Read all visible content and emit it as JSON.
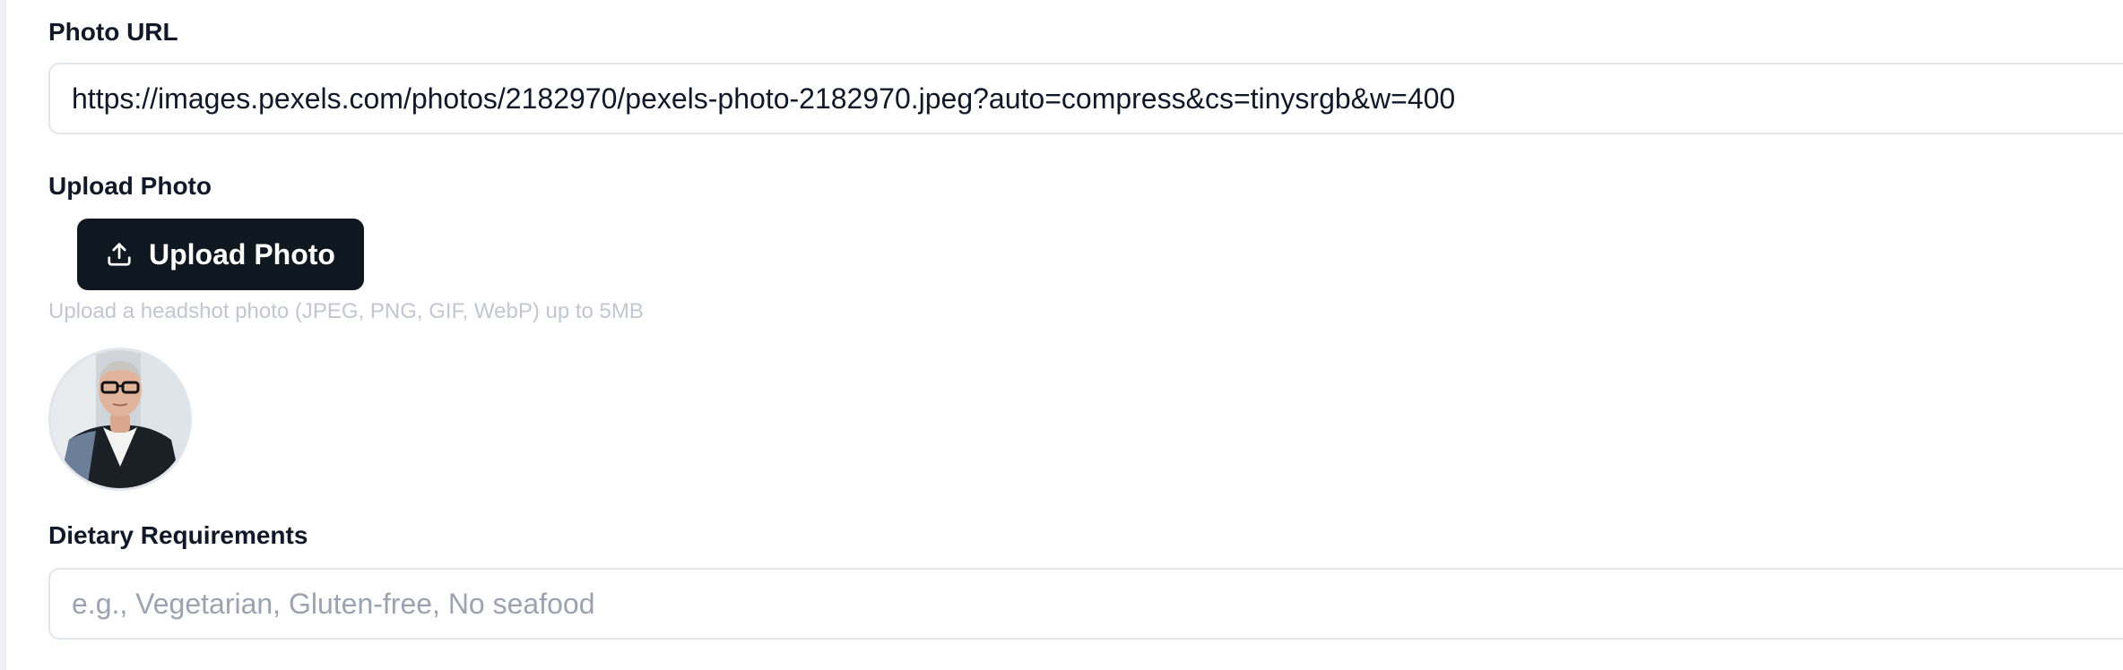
{
  "photo_url": {
    "label": "Photo URL",
    "value": "https://images.pexels.com/photos/2182970/pexels-photo-2182970.jpeg?auto=compress&cs=tinysrgb&w=400"
  },
  "upload_photo": {
    "label": "Upload Photo",
    "button_label": "Upload Photo",
    "button_icon": "upload-icon",
    "hint": "Upload a headshot photo (JPEG, PNG, GIF, WebP) up to 5MB"
  },
  "preview": {
    "image": "headshot-photo"
  },
  "dietary": {
    "label": "Dietary Requirements",
    "value": "",
    "placeholder": "e.g., Vegetarian, Gluten-free, No seafood"
  },
  "colors": {
    "button_bg": "#0f1720",
    "label_text": "#111827",
    "hint_text": "#c2c7cf",
    "input_border": "#e2e5ea",
    "placeholder_text": "#9ca3af"
  }
}
